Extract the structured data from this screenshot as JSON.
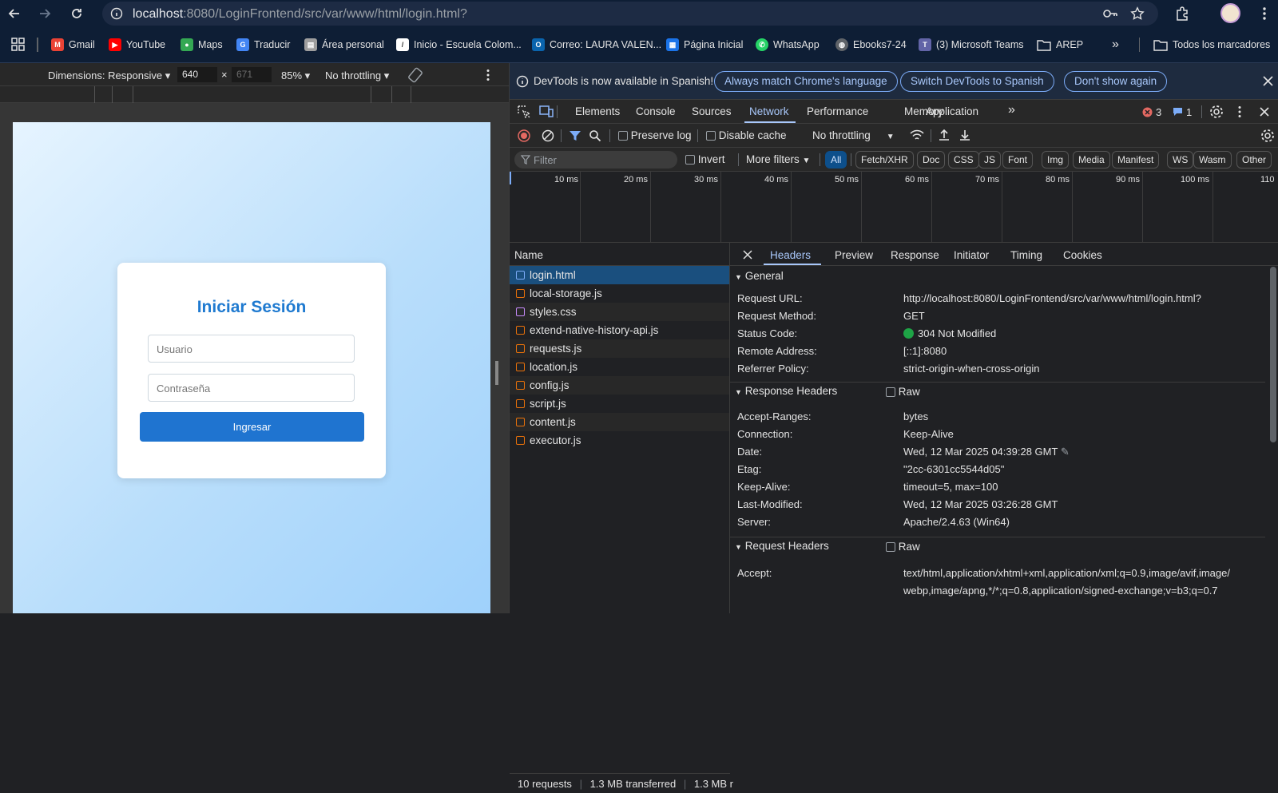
{
  "browser": {
    "url_host": "localhost",
    "url_path": ":8080/LoginFrontend/src/var/www/html/login.html?",
    "bookmarks": [
      "Gmail",
      "YouTube",
      "Maps",
      "Traducir",
      "Área personal",
      "Inicio - Escuela Colom...",
      "Correo: LAURA VALEN...",
      "Página Inicial",
      "WhatsApp",
      "Ebooks7-24",
      "(3) Microsoft Teams",
      "AREP"
    ],
    "all_bookmarks": "Todos los marcadores"
  },
  "device_toolbar": {
    "dimensions": "Dimensions: Responsive",
    "width": "640",
    "times": "×",
    "height": "671",
    "zoom": "85%",
    "throttling": "No throttling"
  },
  "page": {
    "title": "Iniciar Sesión",
    "user_placeholder": "Usuario",
    "password_placeholder": "Contraseña",
    "submit": "Ingresar"
  },
  "devtools": {
    "infobar": {
      "message": "DevTools is now available in Spanish!",
      "btn1": "Always match Chrome's language",
      "btn2": "Switch DevTools to Spanish",
      "btn3": "Don't show again"
    },
    "tabs": [
      "Elements",
      "Console",
      "Sources",
      "Network",
      "Performance",
      "Memory",
      "Application"
    ],
    "errors": "3",
    "messages": "1",
    "toolbar": {
      "preserve_log": "Preserve log",
      "disable_cache": "Disable cache",
      "throttling": "No throttling"
    },
    "filter": {
      "placeholder": "Filter",
      "invert": "Invert",
      "more_filters": "More filters",
      "types": [
        "All",
        "Fetch/XHR",
        "Doc",
        "CSS",
        "JS",
        "Font",
        "Img",
        "Media",
        "Manifest",
        "WS",
        "Wasm",
        "Other"
      ]
    },
    "timeline_labels": [
      "10 ms",
      "20 ms",
      "30 ms",
      "40 ms",
      "50 ms",
      "60 ms",
      "70 ms",
      "80 ms",
      "90 ms",
      "100 ms",
      "110"
    ],
    "list_header": "Name",
    "requests": [
      "login.html",
      "local-storage.js",
      "styles.css",
      "extend-native-history-api.js",
      "requests.js",
      "location.js",
      "config.js",
      "script.js",
      "content.js",
      "executor.js"
    ],
    "status": {
      "requests": "10 requests",
      "transferred": "1.3 MB transferred",
      "resources": "1.3 MB r"
    },
    "detail_tabs": [
      "Headers",
      "Preview",
      "Response",
      "Initiator",
      "Timing",
      "Cookies"
    ],
    "general": {
      "title": "General",
      "rows": [
        {
          "k": "Request URL:",
          "v": "http://localhost:8080/LoginFrontend/src/var/www/html/login.html?"
        },
        {
          "k": "Request Method:",
          "v": "GET"
        },
        {
          "k": "Status Code:",
          "v": "304 Not Modified"
        },
        {
          "k": "Remote Address:",
          "v": "[::1]:8080"
        },
        {
          "k": "Referrer Policy:",
          "v": "strict-origin-when-cross-origin"
        }
      ]
    },
    "response_headers": {
      "title": "Response Headers",
      "raw": "Raw",
      "rows": [
        {
          "k": "Accept-Ranges:",
          "v": "bytes"
        },
        {
          "k": "Connection:",
          "v": "Keep-Alive"
        },
        {
          "k": "Date:",
          "v": "Wed, 12 Mar 2025 04:39:28 GMT"
        },
        {
          "k": "Etag:",
          "v": "\"2cc-6301cc5544d05\""
        },
        {
          "k": "Keep-Alive:",
          "v": "timeout=5, max=100"
        },
        {
          "k": "Last-Modified:",
          "v": "Wed, 12 Mar 2025 03:26:28 GMT"
        },
        {
          "k": "Server:",
          "v": "Apache/2.4.63 (Win64)"
        }
      ]
    },
    "request_headers": {
      "title": "Request Headers",
      "raw": "Raw",
      "accept_key": "Accept:",
      "accept_line1": "text/html,application/xhtml+xml,application/xml;q=0.9,image/avif,image/",
      "accept_line2": "webp,image/apng,*/*;q=0.8,application/signed-exchange;v=b3;q=0.7"
    }
  }
}
